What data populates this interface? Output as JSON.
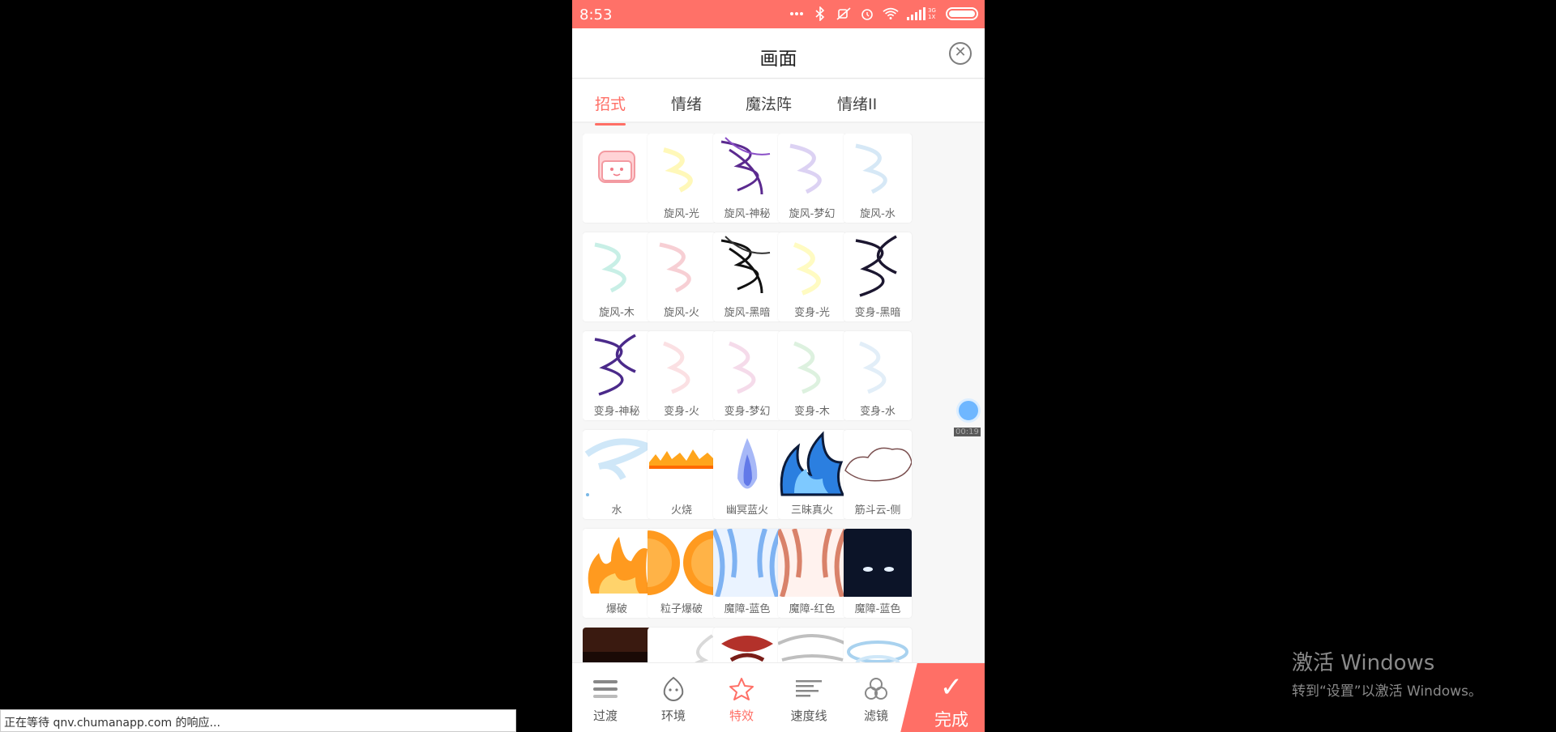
{
  "status": {
    "time": "8:53",
    "network": "3G 1X"
  },
  "header": {
    "title": "画面",
    "close_icon": "close-icon"
  },
  "tabs": [
    {
      "label": "招式",
      "active": true
    },
    {
      "label": "情绪",
      "active": false
    },
    {
      "label": "魔法阵",
      "active": false
    },
    {
      "label": "情绪II",
      "active": false
    }
  ],
  "effects": [
    {
      "label": "",
      "icon": "toast-icon"
    },
    {
      "label": "旋风-光",
      "icon": "whirlwind-light"
    },
    {
      "label": "旋风-神秘",
      "icon": "whirlwind-mystery"
    },
    {
      "label": "旋风-梦幻",
      "icon": "whirlwind-dream"
    },
    {
      "label": "旋风-水",
      "icon": "whirlwind-water"
    },
    {
      "label": "旋风-木",
      "icon": "whirlwind-wood"
    },
    {
      "label": "旋风-火",
      "icon": "whirlwind-fire"
    },
    {
      "label": "旋风-黑暗",
      "icon": "whirlwind-dark"
    },
    {
      "label": "变身-光",
      "icon": "transform-light"
    },
    {
      "label": "变身-黑暗",
      "icon": "transform-dark"
    },
    {
      "label": "变身-神秘",
      "icon": "transform-mystery"
    },
    {
      "label": "变身-火",
      "icon": "transform-fire"
    },
    {
      "label": "变身-梦幻",
      "icon": "transform-dream"
    },
    {
      "label": "变身-木",
      "icon": "transform-wood"
    },
    {
      "label": "变身-水",
      "icon": "transform-water"
    },
    {
      "label": "水",
      "icon": "water-splash"
    },
    {
      "label": "火烧",
      "icon": "fire-burn"
    },
    {
      "label": "幽冥蓝火",
      "icon": "blue-ghost-fire"
    },
    {
      "label": "三昧真火",
      "icon": "samadhi-fire"
    },
    {
      "label": "筋斗云-侧",
      "icon": "cloud-side"
    },
    {
      "label": "爆破",
      "icon": "explosion"
    },
    {
      "label": "粒子爆破",
      "icon": "particle-explosion"
    },
    {
      "label": "魔障-蓝色",
      "icon": "demon-blue"
    },
    {
      "label": "魔障-红色",
      "icon": "demon-red"
    },
    {
      "label": "魔障-蓝色",
      "icon": "demon-blue-dark"
    },
    {
      "label": "",
      "icon": "dark-partial"
    },
    {
      "label": "",
      "icon": "smoke-partial"
    },
    {
      "label": "",
      "icon": "tornado-partial"
    },
    {
      "label": "",
      "icon": "wind-partial"
    },
    {
      "label": "",
      "icon": "swirl-partial"
    }
  ],
  "float": {
    "time": "00:19"
  },
  "bottom_nav": [
    {
      "label": "过渡",
      "icon": "transition-icon",
      "active": false
    },
    {
      "label": "环境",
      "icon": "environment-icon",
      "active": false
    },
    {
      "label": "特效",
      "icon": "star-icon",
      "active": true
    },
    {
      "label": "速度线",
      "icon": "speedline-icon",
      "active": false
    },
    {
      "label": "滤镜",
      "icon": "filter-icon",
      "active": false
    }
  ],
  "done_label": "完成",
  "browser_status": "正在等待 qnv.chumanapp.com 的响应...",
  "watermark": {
    "line1": "激活 Windows",
    "line2": "转到“设置”以激活 Windows。"
  },
  "colors": {
    "accent": "#ff6f66",
    "statusbar": "#ff7168"
  }
}
